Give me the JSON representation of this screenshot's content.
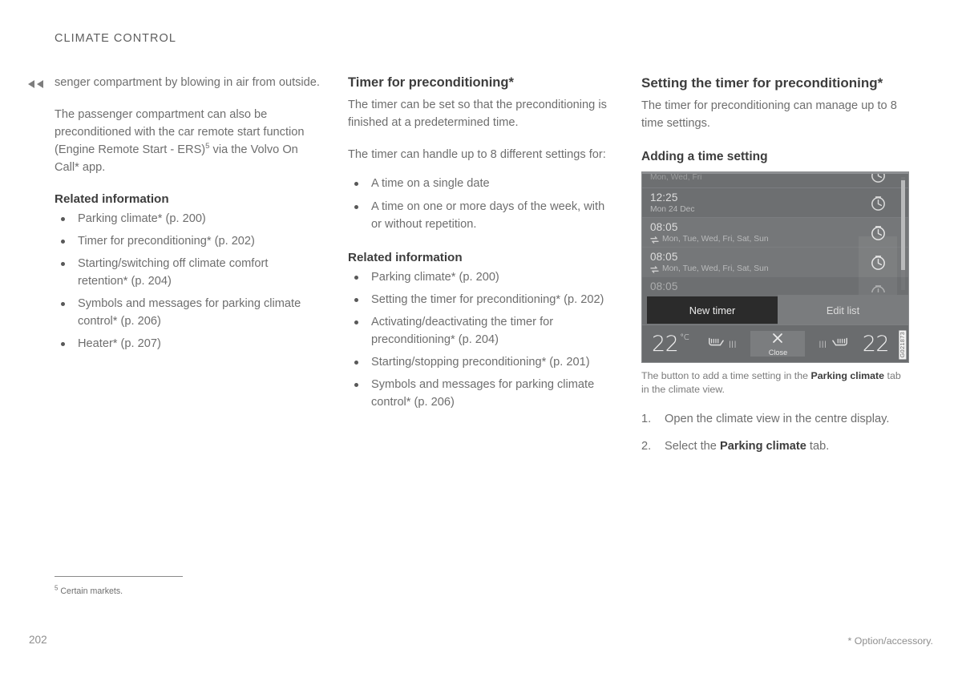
{
  "document": {
    "running_head": "CLIMATE CONTROL",
    "page_number": "202",
    "option_note": "* Option/accessory.",
    "continuation_marker": "double-left-arrow"
  },
  "column_left": {
    "continued_paragraph": "senger compartment by blowing in air from outside.",
    "paragraph_2_part1": "The passenger compartment can also be preconditioned with the car remote start function (Engine Remote Start - ERS)",
    "paragraph_2_footnote_ref": "5",
    "paragraph_2_part2": " via the Volvo On Call* app.",
    "related_heading": "Related information",
    "related_items": [
      "Parking climate* (p. 200)",
      "Timer for preconditioning* (p. 202)",
      "Starting/switching off climate comfort retention* (p. 204)",
      "Symbols and messages for parking climate control* (p. 206)",
      "Heater* (p. 207)"
    ]
  },
  "column_middle": {
    "heading": "Timer for preconditioning*",
    "paragraph_1": "The timer can be set so that the preconditioning is finished at a predetermined time.",
    "paragraph_2": "The timer can handle up to 8 different settings for:",
    "settings_items": [
      "A time on a single date",
      "A time on one or more days of the week, with or without repetition."
    ],
    "related_heading": "Related information",
    "related_items": [
      "Parking climate* (p. 200)",
      "Setting the timer for preconditioning* (p. 202)",
      "Activating/deactivating the timer for preconditioning* (p. 204)",
      "Starting/stopping preconditioning* (p. 201)",
      "Symbols and messages for parking climate control* (p. 206)"
    ]
  },
  "column_right": {
    "heading": "Setting the timer for preconditioning*",
    "paragraph_1": "The timer for preconditioning can manage up to 8 time settings.",
    "subheading": "Adding a time setting",
    "caption_part1": "The button to add a time setting in the ",
    "caption_bold": "Parking climate",
    "caption_part2": " tab in the climate view.",
    "steps": [
      {
        "text_part1": "Open the climate view in the centre display.",
        "bold": "",
        "text_part2": ""
      },
      {
        "text_part1": "Select the ",
        "bold": "Parking climate",
        "text_part2": " tab."
      }
    ]
  },
  "figure": {
    "id_label": "G021873",
    "timer_rows": [
      {
        "time": "",
        "days": "Mon, Wed, Fri",
        "repeat": false,
        "state": "clipped-top"
      },
      {
        "time": "12:25",
        "days": "Mon 24 Dec",
        "repeat": false,
        "state": "normal"
      },
      {
        "time": "08:05",
        "days": "Mon, Tue, Wed, Fri, Sat, Sun",
        "repeat": true,
        "state": "shaded"
      },
      {
        "time": "08:05",
        "days": "Mon, Tue, Wed, Fri, Sat, Sun",
        "repeat": true,
        "state": "shaded"
      },
      {
        "time": "08:05",
        "days": "",
        "repeat": false,
        "state": "clipped-bottom"
      }
    ],
    "buttons": {
      "new_timer": "New timer",
      "edit_list": "Edit list"
    },
    "climate_bar": {
      "temp_left": "22",
      "temp_left_unit": "°C",
      "temp_right": "22",
      "close_label": "Close",
      "seat_level_left": "|||",
      "seat_level_right": "|||"
    },
    "colors": {
      "display_bg": "#6d6f71",
      "row_shaded": "#757779",
      "primary_button": "#2b2b2b",
      "secondary_button": "#7a7c7e",
      "climate_bar": "#6a6c6e"
    }
  },
  "footnote": {
    "marker": "5",
    "text": "Certain markets."
  }
}
